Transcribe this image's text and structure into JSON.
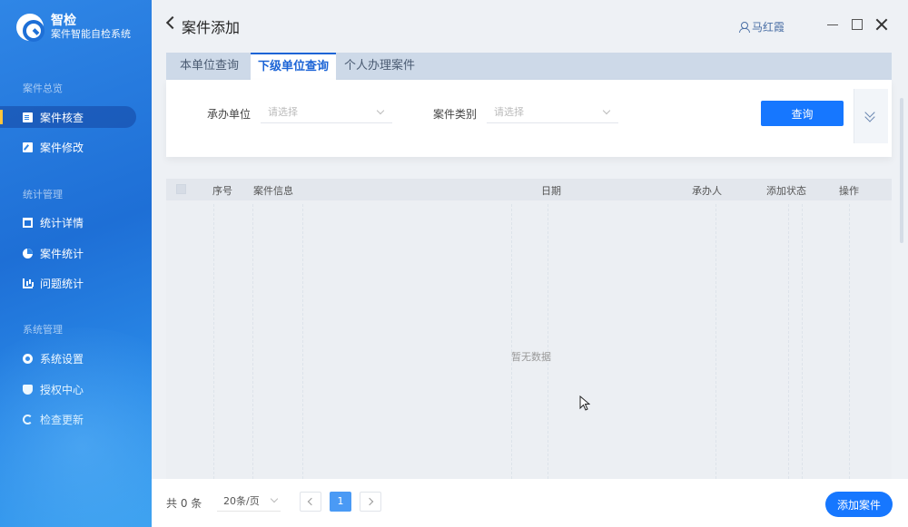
{
  "brand": {
    "name": "智检",
    "subtitle": "案件智能自检系统"
  },
  "sidebar": {
    "sections": [
      {
        "title": "案件总览",
        "items": [
          {
            "label": "案件核查",
            "icon": "document-icon",
            "active": true
          },
          {
            "label": "案件修改",
            "icon": "edit-icon",
            "active": false
          }
        ]
      },
      {
        "title": "统计管理",
        "items": [
          {
            "label": "统计详情",
            "icon": "book-icon",
            "active": false
          },
          {
            "label": "案件统计",
            "icon": "pie-chart-icon",
            "active": false
          },
          {
            "label": "问题统计",
            "icon": "bar-chart-icon",
            "active": false
          }
        ]
      },
      {
        "title": "系统管理",
        "items": [
          {
            "label": "系统设置",
            "icon": "gear-icon",
            "active": false
          },
          {
            "label": "授权中心",
            "icon": "shield-icon",
            "active": false
          },
          {
            "label": "检查更新",
            "icon": "refresh-icon",
            "active": false
          }
        ]
      }
    ]
  },
  "header": {
    "title": "案件添加",
    "user": "马红霞"
  },
  "tabs": [
    {
      "label": "本单位查询",
      "active": false
    },
    {
      "label": "下级单位查询",
      "active": true
    },
    {
      "label": "个人办理案件",
      "active": false
    }
  ],
  "filter": {
    "unit_label": "承办单位",
    "unit_placeholder": "请选择",
    "category_label": "案件类别",
    "category_placeholder": "请选择",
    "query_button": "查询"
  },
  "table": {
    "columns": [
      "序号",
      "案件信息",
      "日期",
      "承办人",
      "添加状态",
      "操作"
    ],
    "empty_text": "暂无数据"
  },
  "footer": {
    "total": "共 0 条",
    "page_size": "20条/页",
    "current_page": "1",
    "add_button": "添加案件"
  },
  "colors": {
    "accent": "#1677ff",
    "sidebar": "#1e6fd6"
  }
}
